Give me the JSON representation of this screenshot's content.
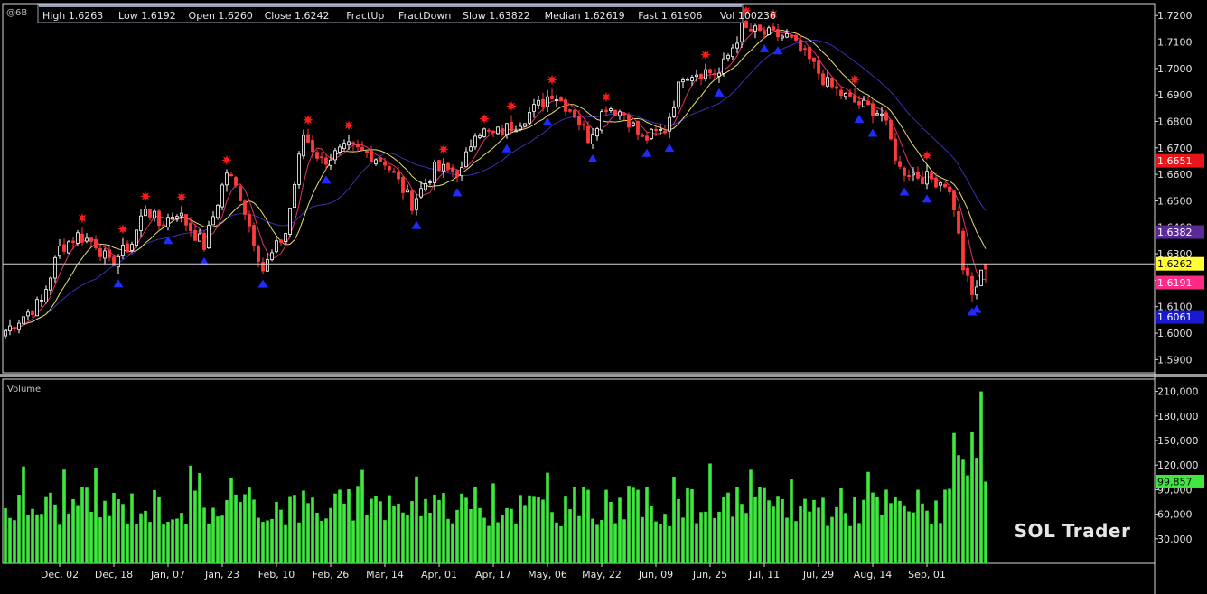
{
  "symbol": "@6B",
  "watermark": "SOL Trader",
  "colors": {
    "background": "#000000",
    "bull_candle": "#ffffff",
    "bear_candle": "#ff3b3b",
    "fractal_up": "#ff1a1a",
    "fractal_down": "#1f2bff",
    "slow_ma": "#3b2fb0",
    "median_ma": "#e8e070",
    "fast_ma": "#e0306a",
    "volume": "#3ee83e",
    "last_price_badge": "#ffff33",
    "fractup_badge": "#e8151b",
    "slow_badge": "#5a2a9a",
    "fast_badge": "#ff2a86",
    "fractdown_badge": "#1818d0",
    "volume_badge": "#3ee83e"
  },
  "legend": [
    {
      "label": "High",
      "value": "1.6263",
      "color": "#ffffff"
    },
    {
      "label": "Low",
      "value": "1.6192",
      "color": "#ffffff"
    },
    {
      "label": "Open",
      "value": "1.6260",
      "color": "#ffffff"
    },
    {
      "label": "Close",
      "value": "1.6242",
      "color": "#ffffff"
    },
    {
      "label": "FractUp",
      "value": "",
      "color": "#ff3030"
    },
    {
      "label": "FractDown",
      "value": "",
      "color": "#3040ff"
    },
    {
      "label": "Slow",
      "value": "1.63822",
      "color": "#3b2fb0"
    },
    {
      "label": "Median",
      "value": "1.62619",
      "color": "#f0e080"
    },
    {
      "label": "Fast",
      "value": "1.61906",
      "color": "#ff3a7a"
    },
    {
      "label": "Vol",
      "value": "100236",
      "color": "#40ff40"
    }
  ],
  "badges": [
    {
      "text": "1.6651",
      "y_value": 1.6651,
      "bg": "#e8151b",
      "fg": "#ffffff"
    },
    {
      "text": "1.6382",
      "y_value": 1.6382,
      "bg": "#5a2a9a",
      "fg": "#ffffff"
    },
    {
      "text": "1.6262",
      "y_value": 1.6262,
      "bg": "#ffff33",
      "fg": "#000000"
    },
    {
      "text": "1.6191",
      "y_value": 1.6191,
      "bg": "#ff2a86",
      "fg": "#ffffff"
    },
    {
      "text": "1.6061",
      "y_value": 1.6061,
      "bg": "#1818d0",
      "fg": "#ffffff"
    }
  ],
  "volume_panel": {
    "title": "Volume",
    "badge": {
      "text": "99,857",
      "value": 99857
    }
  },
  "chart_data": [
    {
      "type": "candlestick",
      "ylim": [
        1.585,
        1.7245
      ],
      "y_ticks": [
        1.59,
        1.6,
        1.61,
        1.62,
        1.63,
        1.64,
        1.65,
        1.66,
        1.67,
        1.68,
        1.69,
        1.7,
        1.71,
        1.72
      ],
      "y_tick_labels": [
        "1.5900",
        "1.6000",
        "1.6100",
        "1.6200",
        "1.6300",
        "1.6400",
        "1.6500",
        "1.6600",
        "1.6700",
        "1.6800",
        "1.6900",
        "1.7000",
        "1.7100",
        "1.7200"
      ],
      "x_tick_labels": [
        {
          "label": "Dec, 02",
          "bar": 12
        },
        {
          "label": "Dec, 18",
          "bar": 24
        },
        {
          "label": "Jan, 07",
          "bar": 36
        },
        {
          "label": "Jan, 23",
          "bar": 48
        },
        {
          "label": "Feb, 10",
          "bar": 60
        },
        {
          "label": "Feb, 26",
          "bar": 72
        },
        {
          "label": "Mar, 14",
          "bar": 84
        },
        {
          "label": "Apr, 01",
          "bar": 96
        },
        {
          "label": "Apr, 17",
          "bar": 108
        },
        {
          "label": "May, 06",
          "bar": 120
        },
        {
          "label": "May, 22",
          "bar": 132
        },
        {
          "label": "Jun, 09",
          "bar": 144
        },
        {
          "label": "Jun, 25",
          "bar": 156
        },
        {
          "label": "Jul, 11",
          "bar": 168
        },
        {
          "label": "Jul, 29",
          "bar": 180
        },
        {
          "label": "Aug, 14",
          "bar": 192
        },
        {
          "label": "Sep, 01",
          "bar": 204
        }
      ],
      "current_price": 1.6262,
      "waypoints": [
        [
          0,
          1.601
        ],
        [
          8,
          1.612
        ],
        [
          12,
          1.632
        ],
        [
          16,
          1.637
        ],
        [
          20,
          1.634
        ],
        [
          23,
          1.626
        ],
        [
          28,
          1.634
        ],
        [
          31,
          1.648
        ],
        [
          34,
          1.641
        ],
        [
          38,
          1.646
        ],
        [
          44,
          1.633
        ],
        [
          49,
          1.661
        ],
        [
          52,
          1.652
        ],
        [
          57,
          1.624
        ],
        [
          62,
          1.638
        ],
        [
          66,
          1.675
        ],
        [
          70,
          1.665
        ],
        [
          76,
          1.67
        ],
        [
          80,
          1.668
        ],
        [
          84,
          1.665
        ],
        [
          90,
          1.649
        ],
        [
          95,
          1.662
        ],
        [
          101,
          1.661
        ],
        [
          104,
          1.677
        ],
        [
          108,
          1.675
        ],
        [
          113,
          1.679
        ],
        [
          118,
          1.686
        ],
        [
          121,
          1.691
        ],
        [
          126,
          1.683
        ],
        [
          129,
          1.674
        ],
        [
          133,
          1.686
        ],
        [
          137,
          1.683
        ],
        [
          141,
          1.673
        ],
        [
          146,
          1.677
        ],
        [
          150,
          1.698
        ],
        [
          155,
          1.699
        ],
        [
          158,
          1.698
        ],
        [
          163,
          1.715
        ],
        [
          168,
          1.713
        ],
        [
          173,
          1.712
        ],
        [
          178,
          1.703
        ],
        [
          182,
          1.694
        ],
        [
          187,
          1.688
        ],
        [
          194,
          1.683
        ],
        [
          198,
          1.662
        ],
        [
          203,
          1.659
        ],
        [
          208,
          1.657
        ],
        [
          210,
          1.648
        ],
        [
          212,
          1.625
        ],
        [
          214,
          1.614
        ],
        [
          216,
          1.622
        ],
        [
          217,
          1.6242
        ]
      ],
      "series": [
        {
          "name": "Slow",
          "color": "#3b2fb0",
          "period": 21
        },
        {
          "name": "Median",
          "color": "#e8e070",
          "period": 10
        },
        {
          "name": "Fast",
          "color": "#e0306a",
          "period": 5
        }
      ]
    },
    {
      "type": "bar",
      "title": "Volume",
      "ylim": [
        0,
        225000
      ],
      "y_ticks": [
        30000,
        60000,
        90000,
        120000,
        150000,
        180000,
        210000
      ],
      "y_tick_labels": [
        "30,000",
        "60,000",
        "90,000",
        "120,000",
        "150,000",
        "180,000",
        "210,000"
      ],
      "last_value": 99857,
      "peak_value": 210000
    }
  ]
}
